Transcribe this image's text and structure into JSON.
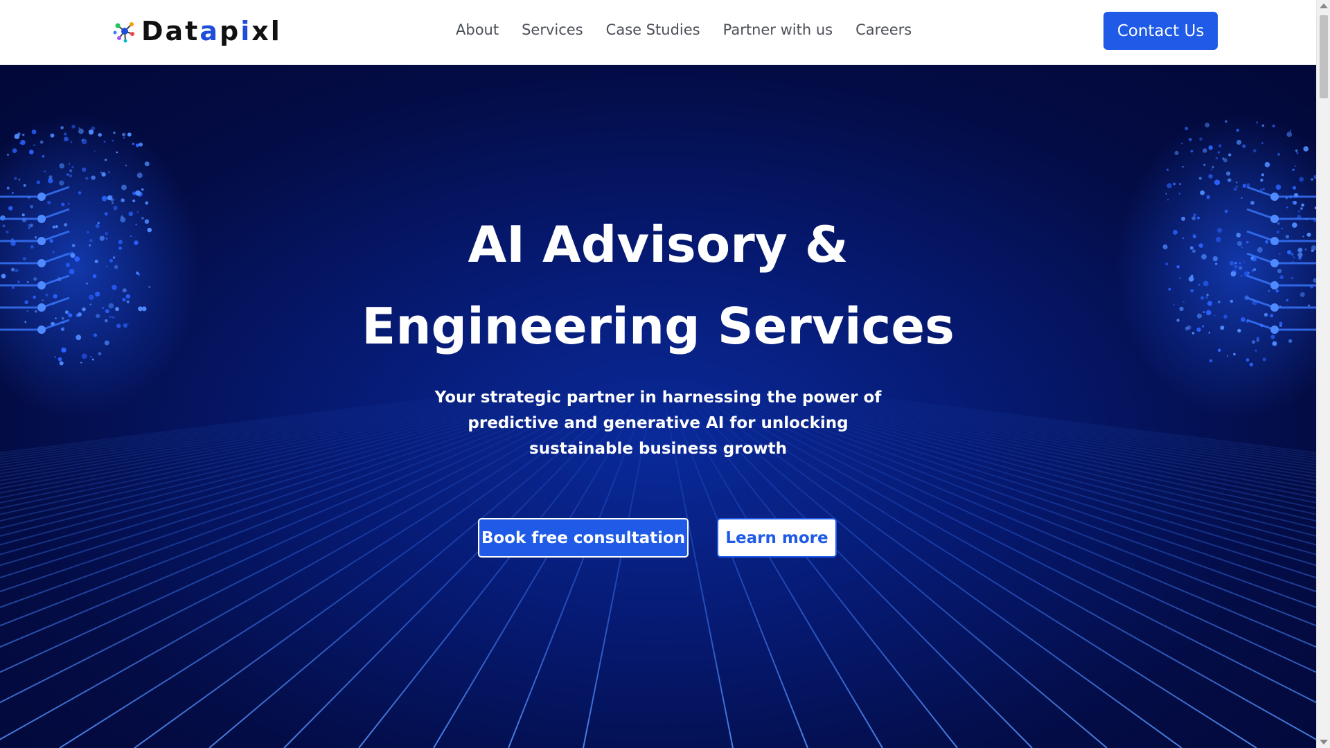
{
  "brand": {
    "name_prefix": "Dat",
    "name_accent_1": "a",
    "name_middle": "p",
    "name_accent_2": "i",
    "name_suffix": "xl",
    "logo_icon": "molecule-icon"
  },
  "nav": {
    "items": [
      {
        "label": "About"
      },
      {
        "label": "Services"
      },
      {
        "label": "Case Studies"
      },
      {
        "label": "Partner with us"
      },
      {
        "label": "Careers"
      }
    ],
    "contact_label": "Contact Us"
  },
  "hero": {
    "title_line_1": "AI Advisory &",
    "title_line_2": "Engineering Services",
    "subtitle": "Your strategic partner in harnessing the power of predictive and generative AI for unlocking sustainable business growth",
    "primary_cta": "Book free consultation",
    "secondary_cta": "Learn more"
  },
  "colors": {
    "accent": "#1f5be6",
    "hero_dark": "#030c45",
    "grid_line": "#3b7bff"
  }
}
